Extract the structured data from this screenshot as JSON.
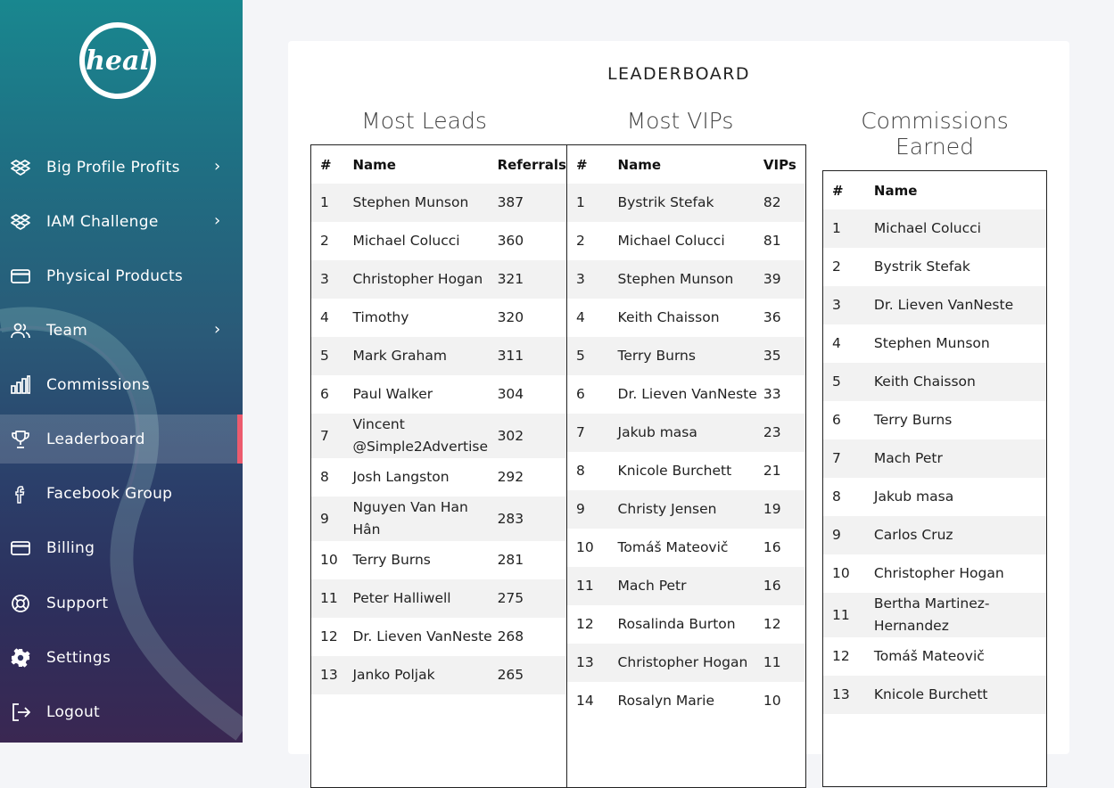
{
  "brand": {
    "logo_text": "heal"
  },
  "sidebar": {
    "items": [
      {
        "label": "Big Profile Profits",
        "icon": "dropbox-icon",
        "has_chevron": true,
        "active": false
      },
      {
        "label": "IAM Challenge",
        "icon": "dropbox-icon",
        "has_chevron": true,
        "active": false
      },
      {
        "label": "Physical Products",
        "icon": "card-icon",
        "has_chevron": false,
        "active": false
      },
      {
        "label": "Team",
        "icon": "users-icon",
        "has_chevron": true,
        "active": false
      },
      {
        "label": "Commissions",
        "icon": "bar-chart-icon",
        "has_chevron": false,
        "active": false
      },
      {
        "label": "Leaderboard",
        "icon": "trophy-icon",
        "has_chevron": false,
        "active": true
      },
      {
        "label": "Facebook Group",
        "icon": "facebook-icon",
        "has_chevron": false,
        "active": false
      },
      {
        "label": "Billing",
        "icon": "card-icon",
        "has_chevron": false,
        "active": false
      },
      {
        "label": "Support",
        "icon": "lifebuoy-icon",
        "has_chevron": false,
        "active": false
      },
      {
        "label": "Settings",
        "icon": "gear-icon",
        "has_chevron": false,
        "active": false
      },
      {
        "label": "Logout",
        "icon": "logout-icon",
        "has_chevron": false,
        "active": false
      }
    ],
    "chevron": "›"
  },
  "leaderboard": {
    "title": "LEADERBOARD",
    "most_leads": {
      "heading": "Most Leads",
      "columns": [
        "#",
        "Name",
        "Referrals"
      ],
      "rows": [
        [
          "1",
          "Stephen Munson",
          "387"
        ],
        [
          "2",
          "Michael Colucci",
          "360"
        ],
        [
          "3",
          "Christopher Hogan",
          "321"
        ],
        [
          "4",
          "Timothy",
          "320"
        ],
        [
          "5",
          "Mark Graham",
          "311"
        ],
        [
          "6",
          "Paul Walker",
          "304"
        ],
        [
          "7",
          "Vincent @Simple2Advertise",
          "302"
        ],
        [
          "8",
          "Josh Langston",
          "292"
        ],
        [
          "9",
          "Nguyen Van Han Hân",
          "283"
        ],
        [
          "10",
          "Terry Burns",
          "281"
        ],
        [
          "11",
          "Peter Halliwell",
          "275"
        ],
        [
          "12",
          "Dr. Lieven VanNeste",
          "268"
        ],
        [
          "13",
          "Janko Poljak",
          "265"
        ]
      ]
    },
    "most_vips": {
      "heading": "Most VIPs",
      "columns": [
        "#",
        "Name",
        "VIPs"
      ],
      "rows": [
        [
          "1",
          "Bystrik Stefak",
          "82"
        ],
        [
          "2",
          "Michael Colucci",
          "81"
        ],
        [
          "3",
          "Stephen Munson",
          "39"
        ],
        [
          "4",
          "Keith Chaisson",
          "36"
        ],
        [
          "5",
          "Terry Burns",
          "35"
        ],
        [
          "6",
          "Dr. Lieven VanNeste",
          "33"
        ],
        [
          "7",
          "Jakub masa",
          "23"
        ],
        [
          "8",
          "Knicole Burchett",
          "21"
        ],
        [
          "9",
          "Christy Jensen",
          "19"
        ],
        [
          "10",
          "Tomáš Mateovič",
          "16"
        ],
        [
          "11",
          "Mach Petr",
          "16"
        ],
        [
          "12",
          "Rosalinda Burton",
          "12"
        ],
        [
          "13",
          "Christopher Hogan",
          "11"
        ],
        [
          "14",
          "Rosalyn Marie",
          "10"
        ]
      ]
    },
    "commissions": {
      "heading": "Commissions Earned",
      "columns": [
        "#",
        "Name"
      ],
      "rows": [
        [
          "1",
          "Michael Colucci"
        ],
        [
          "2",
          "Bystrik Stefak"
        ],
        [
          "3",
          "Dr. Lieven VanNeste"
        ],
        [
          "4",
          "Stephen Munson"
        ],
        [
          "5",
          "Keith Chaisson"
        ],
        [
          "6",
          "Terry Burns"
        ],
        [
          "7",
          "Mach Petr"
        ],
        [
          "8",
          "Jakub masa"
        ],
        [
          "9",
          "Carlos Cruz"
        ],
        [
          "10",
          "Christopher Hogan"
        ],
        [
          "11",
          "Bertha Martinez-Hernandez"
        ],
        [
          "12",
          "Tomáš Mateovič"
        ],
        [
          "13",
          "Knicole Burchett"
        ]
      ]
    }
  },
  "colors": {
    "active_accent": "#ec5b6e",
    "sidebar_top": "#19878f",
    "sidebar_bottom": "#3a2752"
  }
}
